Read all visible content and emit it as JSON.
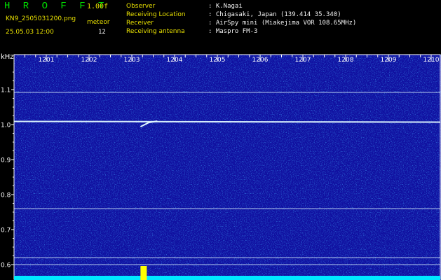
{
  "header": {
    "brand": "H R O F F T",
    "version": "1.00f",
    "filename": "KN9_2505031200.png",
    "datetime": "25.05.03 12:00",
    "meteor_label": "meteor",
    "meteor_count": "12",
    "fields": [
      {
        "label": "Observer",
        "value": ": K.Nagai"
      },
      {
        "label": "Receiving Location",
        "value": ": Chigasaki, Japan (139.414 35.340)"
      },
      {
        "label": "Receiver",
        "value": ": AirSpy mini (Miakejima VOR 108.65MHz)"
      },
      {
        "label": "Receiving antenna",
        "value": ": Maspro FM-3"
      }
    ]
  },
  "chart_data": {
    "type": "heatmap",
    "ylabel": "kHz",
    "time_ticks": [
      "1201",
      "1202",
      "1203",
      "1204",
      "1205",
      "1206",
      "1207",
      "1208",
      "1209",
      "1210"
    ],
    "freq_ticks": [
      "1.1",
      "1.0",
      "0.9",
      "0.8",
      "0.7",
      "0.6"
    ],
    "ylim": [
      0.58,
      1.16
    ],
    "carrier_lines_khz": [
      1.092,
      1.009,
      0.76,
      0.62,
      0.6
    ],
    "meteor_echo": {
      "minute": 1203.4,
      "khz": 1.006
    }
  },
  "colors": {
    "background": "#1010a0",
    "carrier": "#e0f8ff",
    "brand": "#00e000",
    "header_label": "#e8e000",
    "header_value": "#f0f0f0",
    "bottom_bar": "#00e8ff",
    "echo_spike": "#ffff00"
  }
}
